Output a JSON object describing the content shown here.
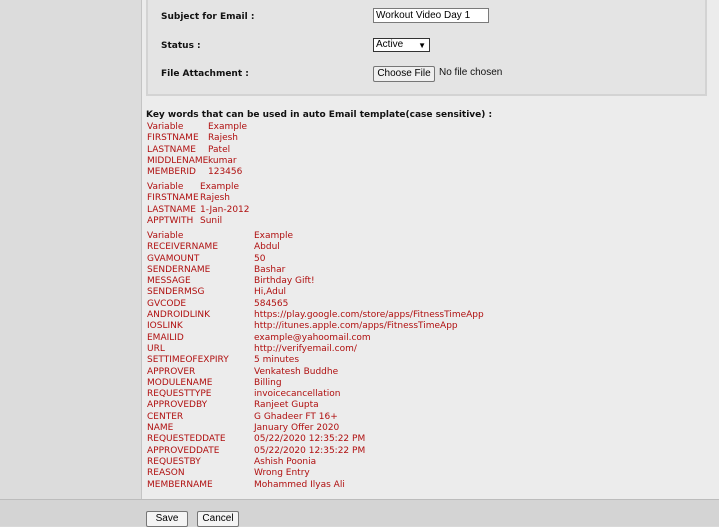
{
  "form": {
    "subject_label": "Subject for Email :",
    "subject_value": "Workout Video Day 1",
    "status_label": "Status :",
    "status_value": "Active",
    "attachment_label": "File Attachment :",
    "choose_file_label": "Choose File",
    "no_file_text": "No file chosen"
  },
  "keywords": {
    "title": "Key words that can be used in auto Email template(case sensitive) :",
    "group1": {
      "header": [
        "Variable",
        "Example"
      ],
      "rows": [
        [
          "FIRSTNAME",
          "Rajesh"
        ],
        [
          "LASTNAME",
          "Patel"
        ],
        [
          "MIDDLENAME",
          "kumar"
        ],
        [
          "MEMBERID",
          "123456"
        ]
      ]
    },
    "group2": {
      "header": [
        "Variable",
        "Example"
      ],
      "rows": [
        [
          "FIRSTNAME",
          "Rajesh"
        ],
        [
          "LASTNAME",
          "1-Jan-2012"
        ],
        [
          "APPTWITH",
          "Sunil"
        ]
      ]
    },
    "group3": {
      "header": [
        "Variable",
        "Example"
      ],
      "rows": [
        [
          "RECEIVERNAME",
          "Abdul"
        ],
        [
          "GVAMOUNT",
          "50"
        ],
        [
          "SENDERNAME",
          "Bashar"
        ],
        [
          "MESSAGE",
          "Birthday Gift!"
        ],
        [
          "SENDERMSG",
          "Hi,Adul"
        ],
        [
          "GVCODE",
          "584565"
        ],
        [
          "ANDROIDLINK",
          "https://play.google.com/store/apps/FitnessTimeApp"
        ],
        [
          "IOSLINK",
          "http://itunes.apple.com/apps/FitnessTimeApp"
        ],
        [
          "EMAILID",
          "example@yahoomail.com"
        ],
        [
          "URL",
          "http://verifyemail.com/"
        ],
        [
          "SETTIMEOFEXPIRY",
          "5 minutes"
        ],
        [
          "APPROVER",
          "Venkatesh Buddhe"
        ],
        [
          "MODULENAME",
          "Billing"
        ],
        [
          "REQUESTTYPE",
          "invoicecancellation"
        ],
        [
          "APPROVEDBY",
          "Ranjeet Gupta"
        ],
        [
          "CENTER",
          "G Ghadeer FT 16+"
        ],
        [
          "NAME",
          "January Offer 2020"
        ],
        [
          "REQUESTEDDATE",
          "05/22/2020 12:35:22 PM"
        ],
        [
          "APPROVEDDATE",
          "05/22/2020 12:35:22 PM"
        ],
        [
          "REQUESTBY",
          "Ashish Poonia"
        ],
        [
          "REASON",
          "Wrong Entry"
        ],
        [
          "MEMBERNAME",
          "Mohammed Ilyas Ali"
        ]
      ]
    }
  },
  "actions": {
    "save_label": "Save",
    "cancel_label": "Cancel"
  }
}
